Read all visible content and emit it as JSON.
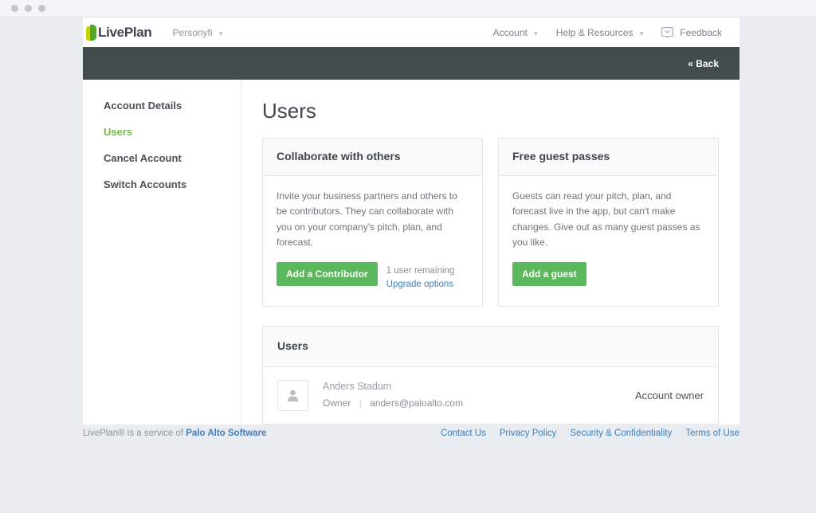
{
  "window": {
    "dots": [
      "close",
      "minimize",
      "maximize"
    ]
  },
  "topbar": {
    "brand": "LivePlan",
    "account_switcher": "Personyfi",
    "caret": "⌄",
    "links": [
      {
        "label": "Account",
        "has_caret": true
      },
      {
        "label": "Help & Resources",
        "has_caret": true
      }
    ],
    "feedback_label": "Feedback"
  },
  "subbar": {
    "back_label": "« Back"
  },
  "sidebar": {
    "items": [
      {
        "label": "Account Details",
        "active": false
      },
      {
        "label": "Users",
        "active": true
      },
      {
        "label": "Cancel Account",
        "active": false
      },
      {
        "label": "Switch Accounts",
        "active": false
      }
    ]
  },
  "main": {
    "page_title": "Users",
    "cards": [
      {
        "title": "Collaborate with others",
        "body": "Invite your business partners and others to be contributors. They can collaborate with you on your company's pitch, plan, and forecast.",
        "button_label": "Add a Contributor",
        "remaining_text": "1 user remaining",
        "upgrade_label": "Upgrade options"
      },
      {
        "title": "Free guest passes",
        "body": "Guests can read your pitch, plan, and forecast live in the app, but can't make changes. Give out as many guest passes as you like.",
        "button_label": "Add a guest"
      }
    ],
    "users_panel": {
      "title": "Users",
      "rows": [
        {
          "name": "Anders Stadum",
          "role": "Owner",
          "separator": "|",
          "email": "anders@paloalto.com",
          "badge": "Account owner"
        }
      ]
    }
  },
  "footer": {
    "left_prefix": "LivePlan® is a service of ",
    "left_company": "Palo Alto Software",
    "links": [
      "Contact Us",
      "Privacy Policy",
      "Security & Confidentiality",
      "Terms of Use"
    ]
  },
  "colors": {
    "accent_green": "#5cb85c",
    "active_green": "#72bf44",
    "dark_bar": "#424b4d",
    "link_blue": "#3e7fbf",
    "page_bg": "#e9ecf0"
  }
}
